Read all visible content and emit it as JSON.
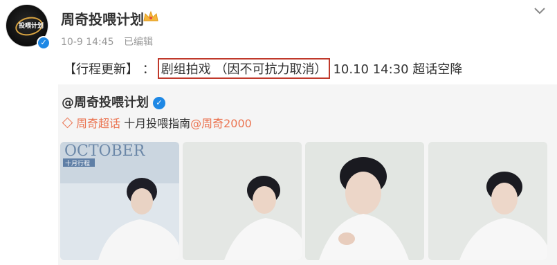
{
  "user": {
    "name": "周奇投喂计划",
    "avatar_logo": "投喂计划",
    "timestamp": "10-9 14:45",
    "edited": "已编辑"
  },
  "post": {
    "prefix": "【行程更新】 ：",
    "highlight": "剧组拍戏 （因不可抗力取消）",
    "suffix": "10.10 14:30 超话空降"
  },
  "repost": {
    "author": "@周奇投喂计划",
    "supertopic": "周奇超话",
    "text": "十月投喂指南",
    "mention": "@周奇2000",
    "thumbnail_text": [
      "OCTOBER",
      "十月行程"
    ]
  },
  "icons": {
    "verified": "verified-badge-icon",
    "crown": "vip-crown-icon",
    "menu": "chevron-down-icon",
    "supertopic": "supertopic-diamond-icon"
  },
  "colors": {
    "highlight_border": "#c0392b",
    "link": "#eb7350",
    "verified": "#1e88e5",
    "repost_bg": "#f5f5f5"
  }
}
